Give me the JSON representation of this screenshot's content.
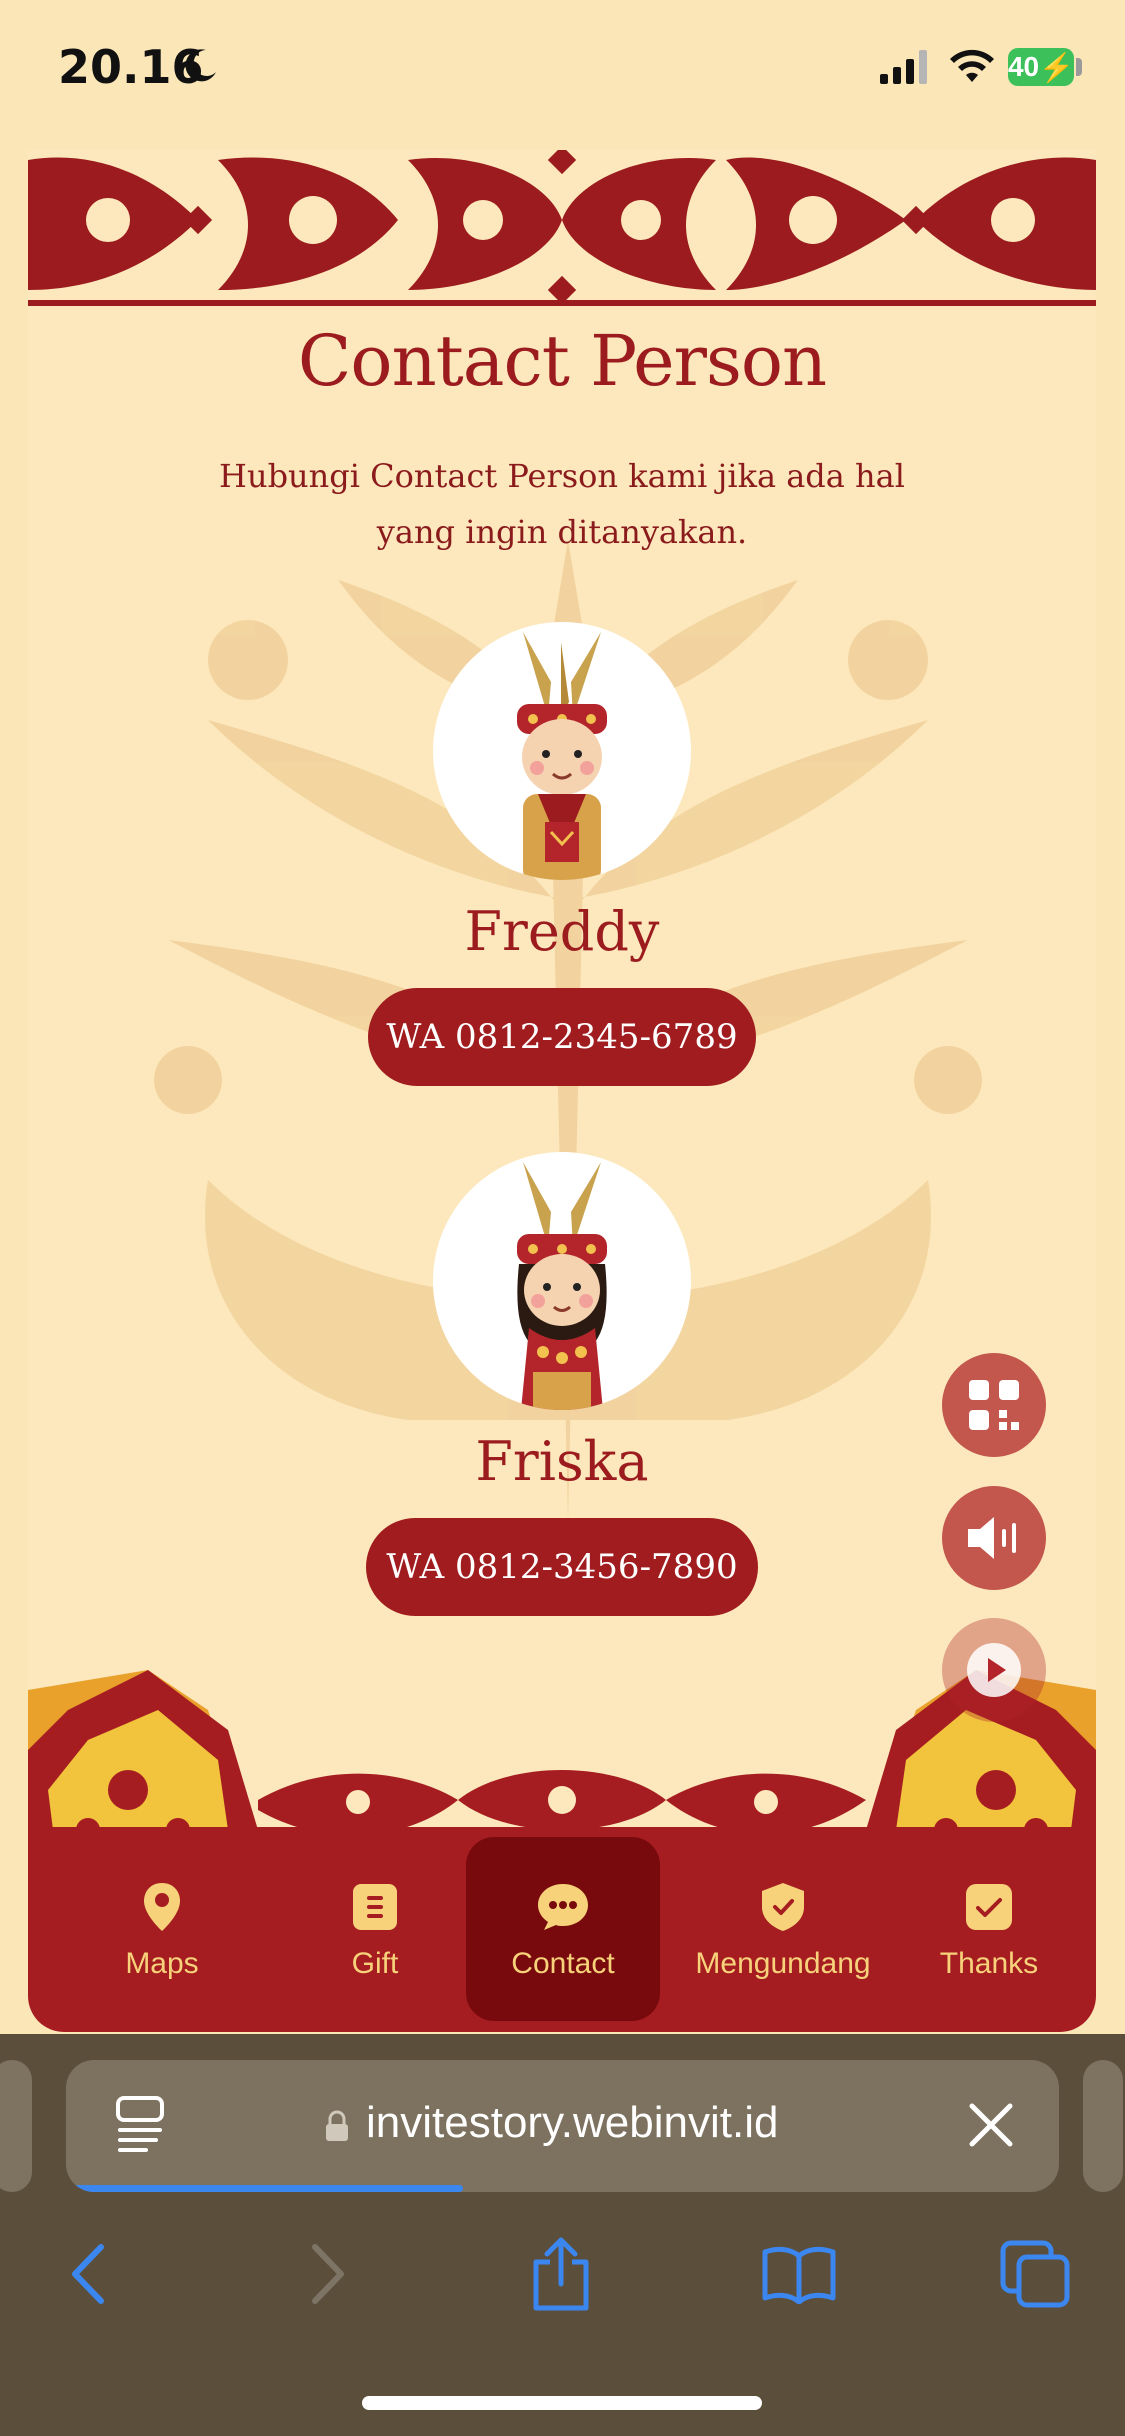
{
  "status_bar": {
    "time": "20.16",
    "battery": "40"
  },
  "page": {
    "title": "Contact Person",
    "subtitle": "Hubungi Contact Person kami jika ada hal yang ingin ditanyakan."
  },
  "contacts": [
    {
      "name": "Freddy",
      "wa_label": "WA 0812-2345-6789"
    },
    {
      "name": "Friska",
      "wa_label": "WA 0812-3456-7890"
    }
  ],
  "tabs": [
    {
      "label": "Maps",
      "icon": "location-pin-icon"
    },
    {
      "label": "Gift",
      "icon": "gift-icon"
    },
    {
      "label": "Contact",
      "icon": "chat-bubble-icon",
      "active": true
    },
    {
      "label": "Mengundang",
      "icon": "shield-check-icon"
    },
    {
      "label": "Thanks",
      "icon": "check-badge-icon"
    }
  ],
  "browser": {
    "url": "invitestory.webinvit.id",
    "load_progress": 0.4
  },
  "colors": {
    "accent": "#a61d21",
    "active_tab": "#780a0d",
    "tab_text": "#f7d27a",
    "background": "#fbe6b7"
  }
}
